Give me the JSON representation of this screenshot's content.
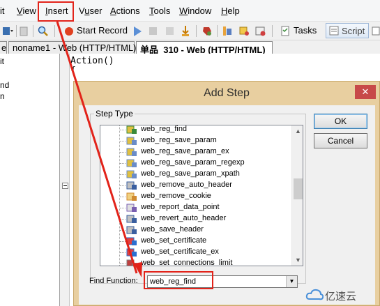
{
  "menubar": {
    "items": [
      {
        "label": "it",
        "underline": ""
      },
      {
        "label": "View",
        "underline": "V"
      },
      {
        "label": "Insert",
        "underline": "I"
      },
      {
        "label": "Vuser",
        "underline": "u"
      },
      {
        "label": "Actions",
        "underline": "A"
      },
      {
        "label": "Tools",
        "underline": "T"
      },
      {
        "label": "Window",
        "underline": "W"
      },
      {
        "label": "Help",
        "underline": "H"
      }
    ]
  },
  "toolbar": {
    "start_record_label": "Start Record",
    "tasks_label": "Tasks",
    "script_label": "Script",
    "icons": [
      "dropdown-arrow-icon",
      "paste-icon",
      "search-icon",
      "record-icon",
      "run-icon",
      "stop-icon",
      "pause-icon",
      "step-icon",
      "compile-icon",
      "breakpoint-icon",
      "parameter-icon",
      "correlation-icon",
      "tasks-icon",
      "script-view-icon",
      "tree-view-icon"
    ]
  },
  "tabs": [
    {
      "label": "e"
    },
    {
      "label": "noname1 - Web (HTTP/HTML)"
    },
    {
      "label": "单品_310 - Web (HTTP/HTML)",
      "active": true
    }
  ],
  "left_panel": {
    "items": [
      "it",
      "nd",
      "n"
    ]
  },
  "editor": {
    "lines": [
      "Action()",
      "{"
    ]
  },
  "dialog": {
    "title": "Add Step",
    "close_label": "✕",
    "group_label": "Step Type",
    "ok_label": "OK",
    "cancel_label": "Cancel",
    "find_label": "Find Function:",
    "find_value": "web_reg_find",
    "steps": [
      {
        "label": "web_reg_find",
        "icon": "find-step-icon"
      },
      {
        "label": "web_reg_save_param",
        "icon": "save-param-icon"
      },
      {
        "label": "web_reg_save_param_ex",
        "icon": "save-param-icon"
      },
      {
        "label": "web_reg_save_param_regexp",
        "icon": "save-param-icon"
      },
      {
        "label": "web_reg_save_param_xpath",
        "icon": "save-param-icon"
      },
      {
        "label": "web_remove_auto_header",
        "icon": "header-icon"
      },
      {
        "label": "web_remove_cookie",
        "icon": "cookie-icon"
      },
      {
        "label": "web_report_data_point",
        "icon": "report-icon"
      },
      {
        "label": "web_revert_auto_header",
        "icon": "header-icon"
      },
      {
        "label": "web_save_header",
        "icon": "header-icon"
      },
      {
        "label": "web_set_certificate",
        "icon": "certificate-icon"
      },
      {
        "label": "web_set_certificate_ex",
        "icon": "certificate-icon"
      },
      {
        "label": "web_set_connections_limit",
        "icon": "settings-icon"
      }
    ]
  },
  "watermark": {
    "text": "亿速云"
  },
  "colors": {
    "annotation": "#e2231a",
    "dialog_frame": "#e8cfa0",
    "close_button": "#c74949"
  }
}
